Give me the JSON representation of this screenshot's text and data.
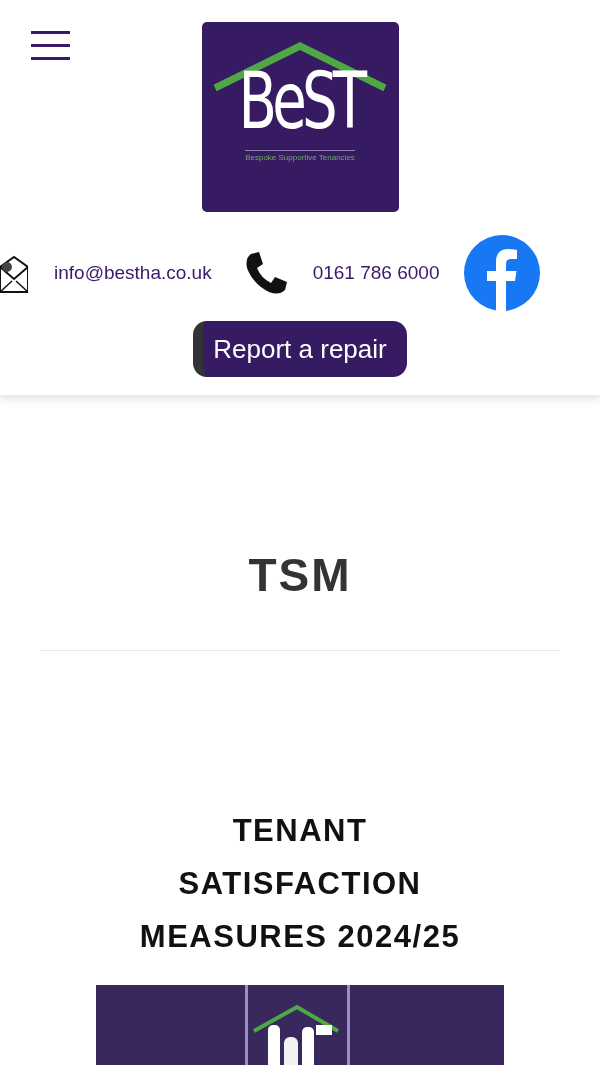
{
  "header": {
    "logo": {
      "wordmark": "BeST",
      "tagline": "Bespoke Supportive Tenancies"
    },
    "contacts": [
      {
        "kind": "email",
        "text": "info@bestha.co.uk"
      },
      {
        "kind": "phone",
        "text": "0161 786 6000"
      },
      {
        "kind": "facebook"
      }
    ],
    "button": "Report a repair"
  },
  "page_title": "TSM",
  "section_heading": "TENANT SATISFACTION MEASURES 2024/25"
}
